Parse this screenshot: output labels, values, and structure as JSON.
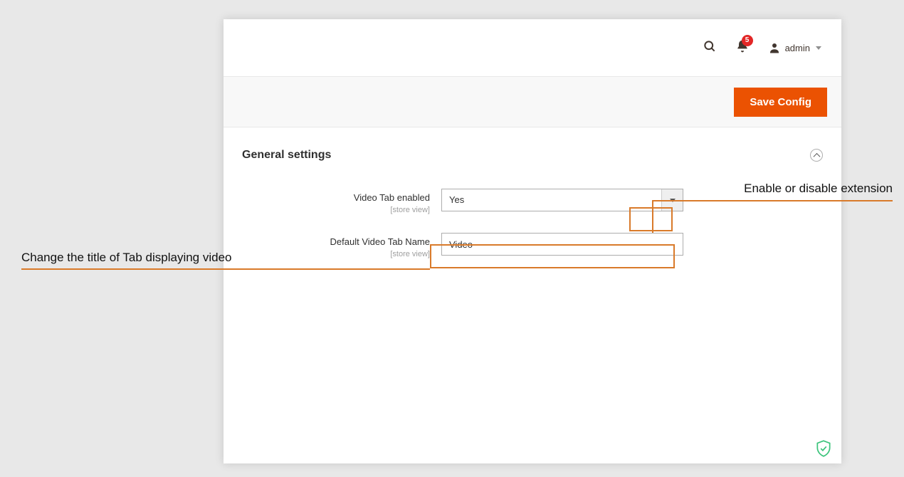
{
  "header": {
    "notification_count": "5",
    "username": "admin"
  },
  "actions": {
    "save_label": "Save Config"
  },
  "section": {
    "title": "General settings",
    "fields": {
      "video_tab_enabled": {
        "label": "Video Tab enabled",
        "scope": "[store view]",
        "value": "Yes"
      },
      "default_video_tab_name": {
        "label": "Default Video Tab Name",
        "scope": "[store view]",
        "value": "Video"
      }
    }
  },
  "annotations": {
    "enable_disable": "Enable or disable extension",
    "change_title": "Change the title of Tab displaying video"
  }
}
